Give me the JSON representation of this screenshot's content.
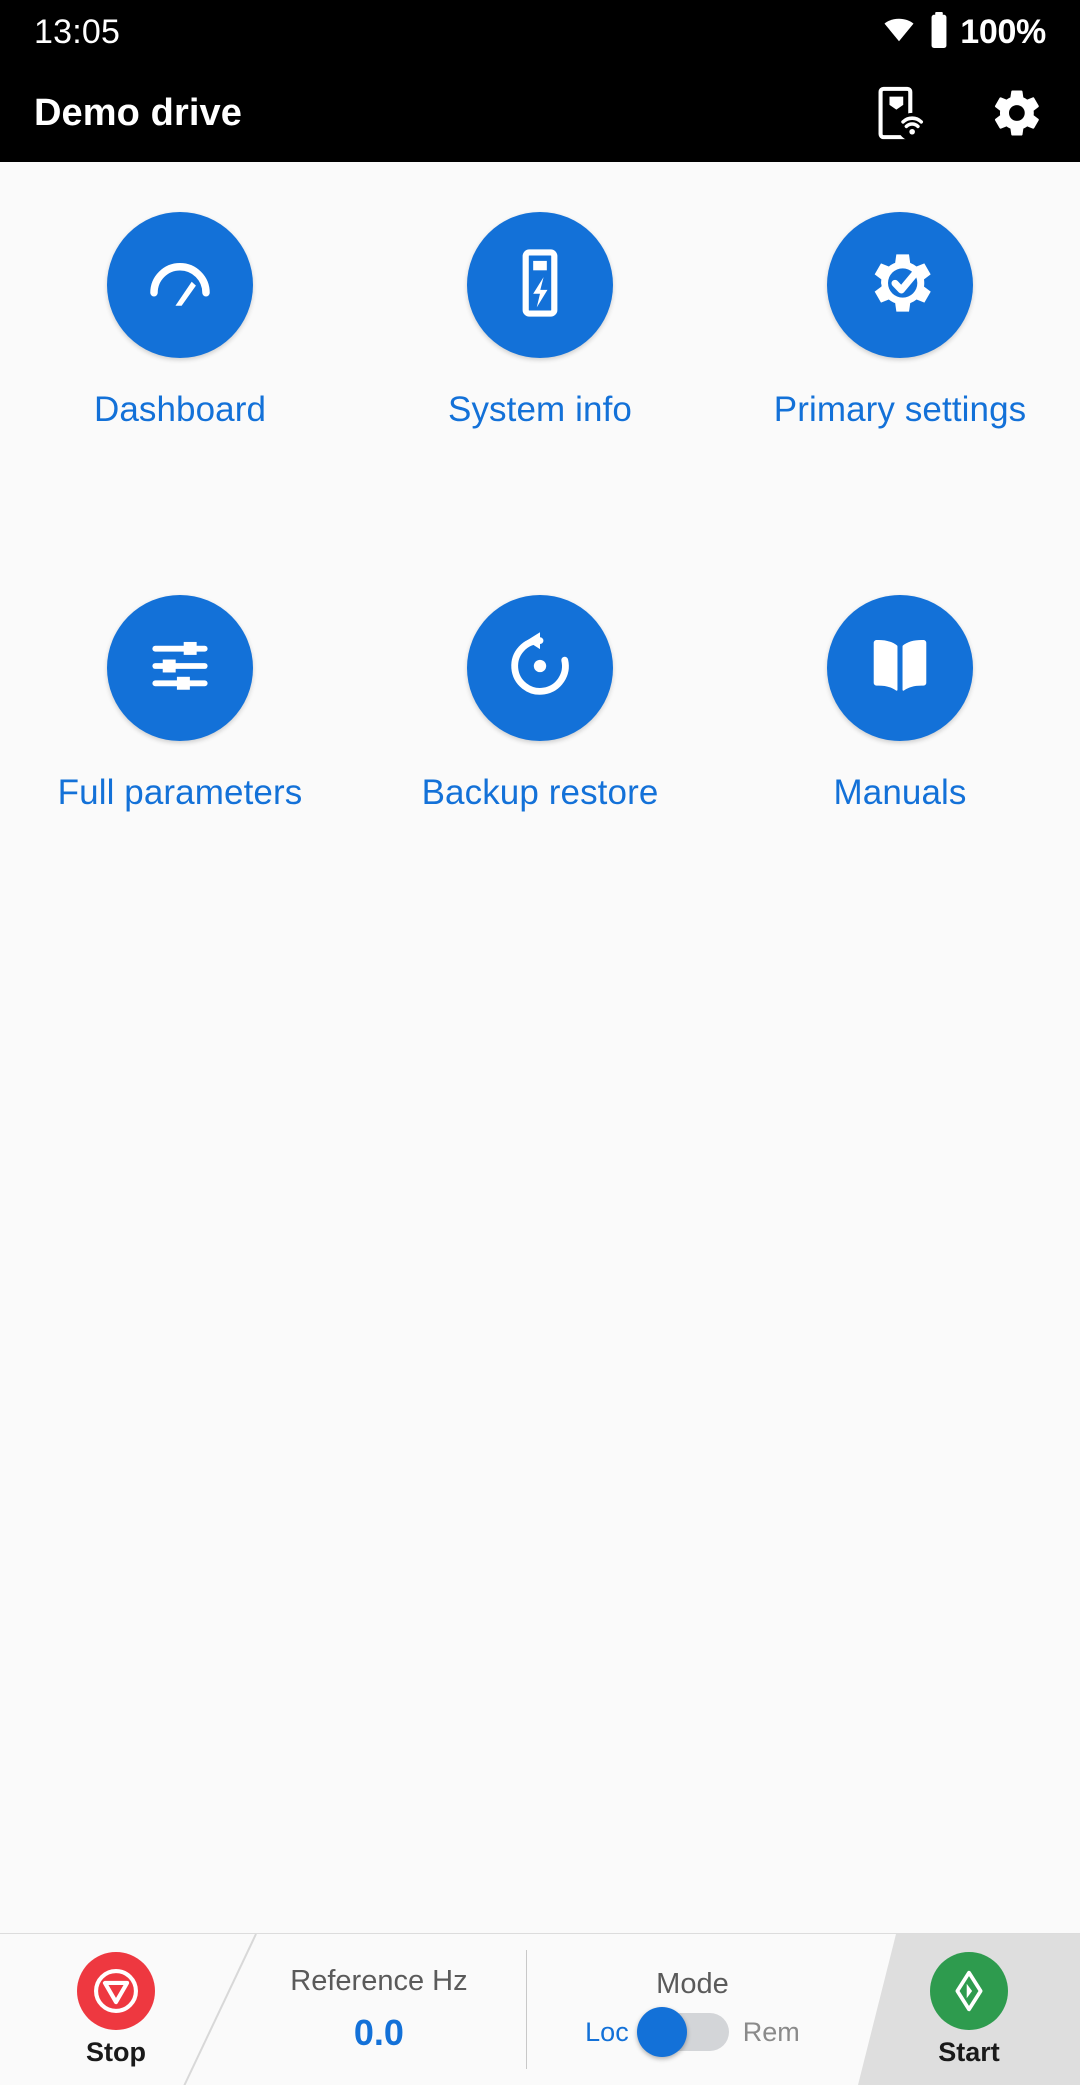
{
  "status_bar": {
    "time": "13:05",
    "battery_percent": "100%",
    "wifi_icon": "wifi-icon",
    "battery_icon": "battery-full-icon"
  },
  "app_bar": {
    "title": "Demo drive",
    "actions": [
      {
        "name": "drive-connection-icon",
        "label": "Drive connection"
      },
      {
        "name": "gear-icon",
        "label": "Settings"
      }
    ]
  },
  "menu": {
    "tiles": [
      {
        "label": "Dashboard",
        "icon": "gauge-icon"
      },
      {
        "label": "System info",
        "icon": "drive-bolt-icon"
      },
      {
        "label": "Primary settings",
        "icon": "gear-check-icon"
      },
      {
        "label": "Full parameters",
        "icon": "sliders-icon"
      },
      {
        "label": "Backup restore",
        "icon": "restore-icon"
      },
      {
        "label": "Manuals",
        "icon": "book-icon"
      }
    ]
  },
  "bottom_bar": {
    "stop": {
      "label": "Stop",
      "icon": "stop-icon",
      "color": "#ee3840"
    },
    "reference": {
      "title": "Reference Hz",
      "value": "0.0",
      "color": "#1371d8"
    },
    "mode": {
      "title": "Mode",
      "left_label": "Loc",
      "right_label": "Rem",
      "selected": "Loc"
    },
    "start": {
      "label": "Start",
      "icon": "start-icon",
      "color": "#2e9b4e"
    }
  },
  "theme": {
    "accent": "#1371d8",
    "background": "#fafafa",
    "bar_background": "#000000"
  }
}
